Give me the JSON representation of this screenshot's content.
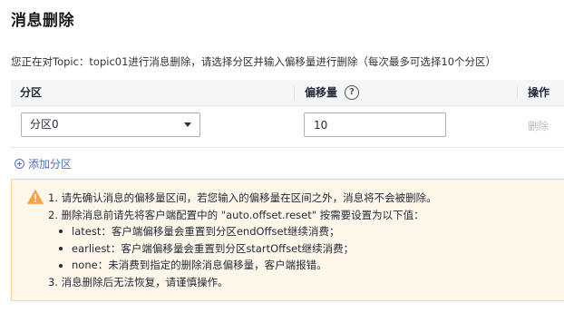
{
  "page": {
    "title": "消息删除",
    "description": "您正在对Topic：topic01进行消息删除，请选择分区并输入偏移量进行删除（每次最多可选择10个分区）"
  },
  "table": {
    "headers": {
      "partition": "分区",
      "offset": "偏移量",
      "operation": "操作"
    },
    "rows": [
      {
        "partition": "分区0",
        "offset": "10",
        "action": "删除"
      }
    ]
  },
  "add_partition_label": "添加分区",
  "notice": {
    "lines": [
      "1. 请先确认消息的偏移量区间，若您输入的偏移量在区间之外，消息将不会被删除。",
      "2. 删除消息前请先将客户端配置中的 \"auto.offset.reset\" 按需要设置为以下值："
    ],
    "bullets": [
      "latest：客户端偏移量会重置到分区endOffset继续消费；",
      "earliest：客户端偏移量会重置到分区startOffset继续消费；",
      "none：未消费到指定的删除消息偏移量，客户端报错。"
    ],
    "last_line": "3. 消息删除后无法恢复，请谨慎操作。"
  },
  "colors": {
    "accent": "#526ecc",
    "warning": "#f66f6a",
    "notice_bg": "#fff7ea",
    "notice_border": "#ffd590"
  },
  "icons": {
    "help": "question-circle-icon",
    "add": "plus-circle-icon",
    "warning": "warning-triangle-icon",
    "select": "caret-down-icon"
  }
}
